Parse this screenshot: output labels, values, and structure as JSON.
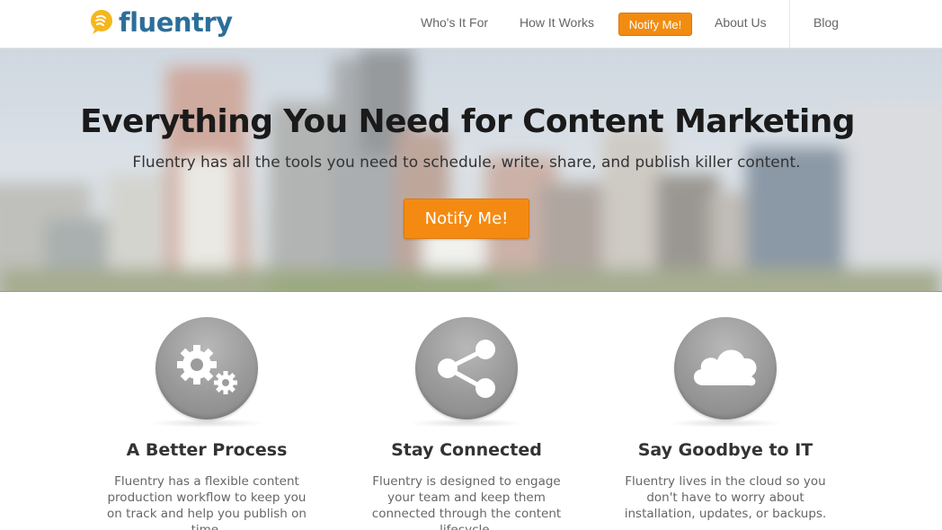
{
  "brand": {
    "name": "fluentry",
    "accent": "#f28c11",
    "logo_color": "#2c6e9a",
    "logo_mark_color": "#f5b71d"
  },
  "nav": {
    "items": [
      {
        "label": "Who's It For"
      },
      {
        "label": "How It Works"
      },
      {
        "label": "About Us"
      },
      {
        "label": "Blog"
      }
    ],
    "cta_label": "Notify Me!"
  },
  "hero": {
    "title": "Everything You Need for Content Marketing",
    "subtitle": "Fluentry has all the tools you need to schedule, write, share, and publish killer content.",
    "button_label": "Notify Me!"
  },
  "features": [
    {
      "icon": "gears-icon",
      "title": "A Better Process",
      "text": "Fluentry has a flexible content production workflow to keep you on track and help you publish on time."
    },
    {
      "icon": "share-icon",
      "title": "Stay Connected",
      "text": "Fluentry is designed to engage your team and keep them connected through the content lifecycle."
    },
    {
      "icon": "cloud-icon",
      "title": "Say Goodbye to IT",
      "text": "Fluentry lives in the cloud so you don't have to worry about installation, updates, or backups."
    }
  ]
}
